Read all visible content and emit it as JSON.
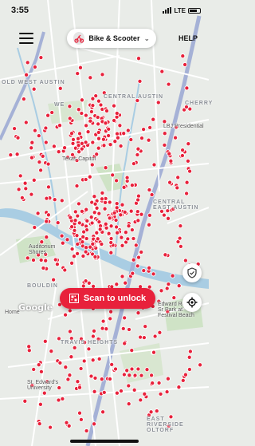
{
  "status_bar": {
    "time": "3:55",
    "carrier": "LTE"
  },
  "header": {
    "mode_label": "Bike & Scooter",
    "help_label": "HELP"
  },
  "map": {
    "labels": {
      "old_west_austin": "OLD WEST AUSTIN",
      "central_austin": "CENTRAL AUSTIN",
      "cherry": "CHERRY",
      "w_campus": "WE",
      "lbj_library": "LBJ Presidential",
      "texas_capitol": "Texas Capitol",
      "central_east_austin": "CENTRAL EAST AUSTIN",
      "auditorium_shores": "Auditorium Shores",
      "bouldin": "BOULDIN",
      "home_depot": "Home",
      "travis_heights": "TRAVIS HEIGHTS",
      "edward_rendon": "Edward Rendon Sr Park at Festival Beach",
      "st_edwards": "St. Edward's University",
      "east_riverside": "EAST RIVERSIDE OLTORF"
    },
    "google_logo": "Google",
    "colors": {
      "vehicle_dot": "#e8213b",
      "water": "#a9cde3",
      "park": "#cfe3c6",
      "road": "#ffffff",
      "highway": "#a5b1d6"
    }
  },
  "actions": {
    "scan_label": "Scan to unlock"
  },
  "icons": {
    "menu": "hamburger-icon",
    "mode": "scooter-icon",
    "dropdown": "chevron-down-icon",
    "safety": "shield-check-icon",
    "locate": "crosshair-icon",
    "scan": "qr-code-icon"
  }
}
